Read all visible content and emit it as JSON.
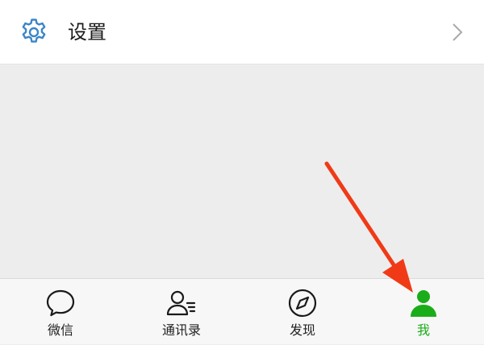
{
  "settings": {
    "label": "设置",
    "icon": "gear-icon",
    "trailing_icon": "chevron-right-icon"
  },
  "tab_bar": {
    "items": [
      {
        "label": "微信",
        "icon": "chat-bubble-icon",
        "active": false
      },
      {
        "label": "通讯录",
        "icon": "contacts-icon",
        "active": false
      },
      {
        "label": "发现",
        "icon": "compass-icon",
        "active": false
      },
      {
        "label": "我",
        "icon": "person-icon",
        "active": true
      }
    ]
  },
  "annotation": {
    "type": "arrow",
    "target": "tab-me",
    "color": "#f03a17"
  },
  "colors": {
    "accent": "#1aad19",
    "settings_icon": "#3a86c8",
    "background": "#ededed"
  }
}
